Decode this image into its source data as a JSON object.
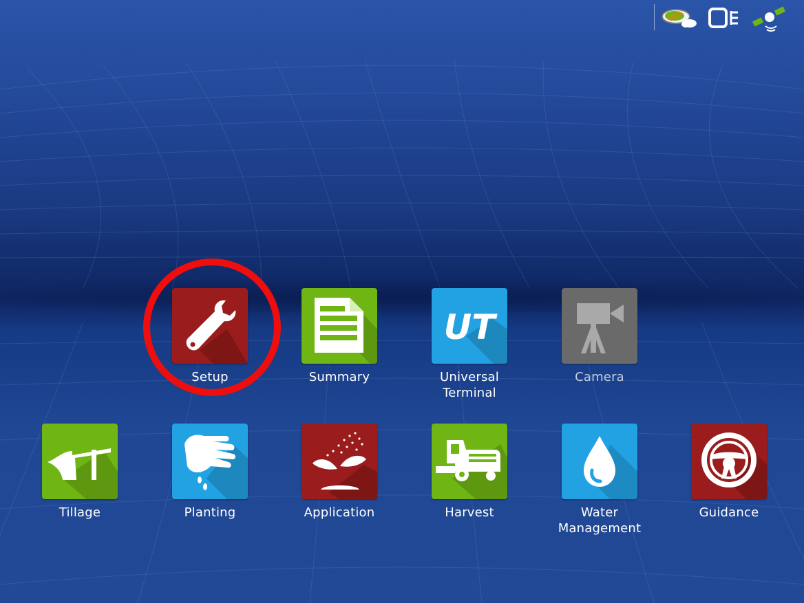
{
  "status_bar": {
    "icons": [
      "connectivity-cloud-icon",
      "display-network-icon",
      "gps-satellite-icon"
    ]
  },
  "apps": {
    "setup": {
      "label": "Setup",
      "icon": "wrench-icon",
      "color": "#9a1c1c"
    },
    "summary": {
      "label": "Summary",
      "icon": "document-icon",
      "color": "#6fb514"
    },
    "universal_terminal": {
      "label": "Universal\nTerminal",
      "icon": "ut-logo-icon",
      "color": "#22a2e2"
    },
    "camera": {
      "label": "Camera",
      "icon": "video-camera-icon",
      "color": "#6a6a6a"
    },
    "tillage": {
      "label": "Tillage",
      "icon": "plow-icon",
      "color": "#6fb514"
    },
    "planting": {
      "label": "Planting",
      "icon": "hand-seed-icon",
      "color": "#22a2e2"
    },
    "application": {
      "label": "Application",
      "icon": "sprout-spray-icon",
      "color": "#9a1c1c"
    },
    "harvest": {
      "label": "Harvest",
      "icon": "combine-icon",
      "color": "#6fb514"
    },
    "water_management": {
      "label": "Water\nManagement",
      "icon": "water-drop-icon",
      "color": "#22a2e2"
    },
    "guidance": {
      "label": "Guidance",
      "icon": "steering-wheel-icon",
      "color": "#9a1c1c"
    }
  },
  "highlight": {
    "target": "setup",
    "color": "#ee0e0e"
  }
}
